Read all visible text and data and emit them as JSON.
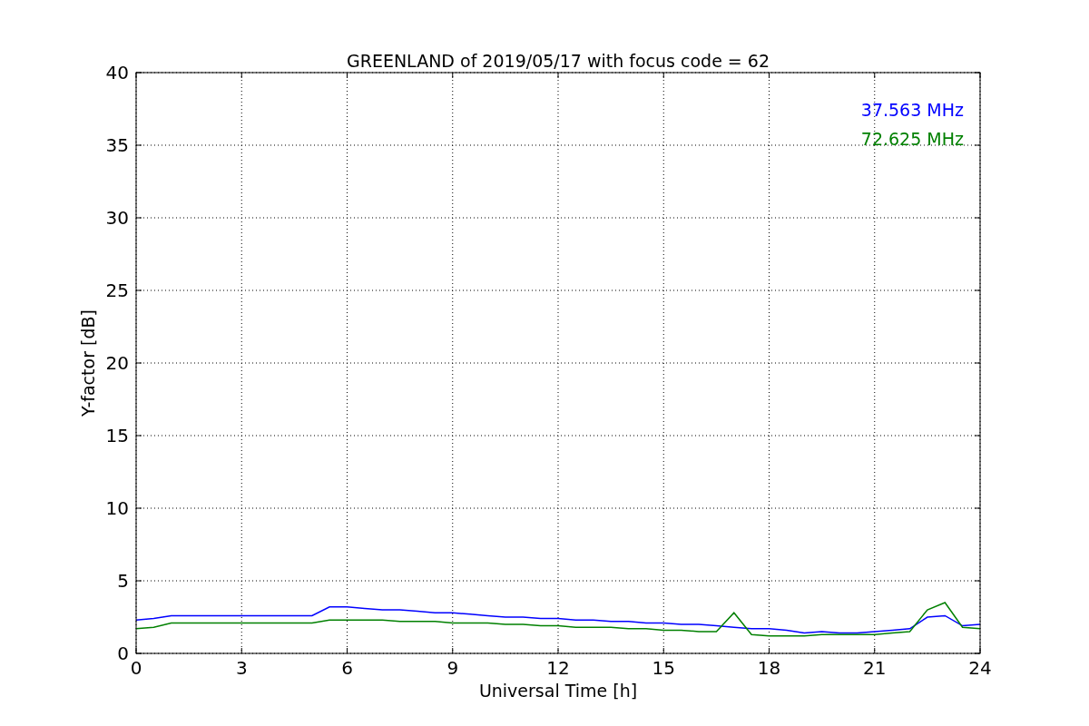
{
  "figure": {
    "chart_data": {
      "type": "line",
      "title": "GREENLAND of 2019/05/17 with focus code = 62",
      "xlabel": "Universal Time [h]",
      "ylabel": "Y-factor [dB]",
      "x": [
        0,
        0.5,
        1,
        1.5,
        2,
        2.5,
        3,
        3.5,
        4,
        4.5,
        5,
        5.5,
        6,
        6.5,
        7,
        7.5,
        8,
        8.5,
        9,
        9.5,
        10,
        10.5,
        11,
        11.5,
        12,
        12.5,
        13,
        13.5,
        14,
        14.5,
        15,
        15.5,
        16,
        16.5,
        17,
        17.5,
        18,
        18.5,
        19,
        19.5,
        20,
        20.5,
        21,
        21.5,
        22,
        22.5,
        23,
        23.5,
        24
      ],
      "series": [
        {
          "name": "37.563 MHz",
          "color": "#0000ff",
          "values": [
            2.3,
            2.4,
            2.6,
            2.6,
            2.6,
            2.6,
            2.6,
            2.6,
            2.6,
            2.6,
            2.6,
            3.2,
            3.2,
            3.1,
            3.0,
            3.0,
            2.9,
            2.8,
            2.8,
            2.7,
            2.6,
            2.5,
            2.5,
            2.4,
            2.4,
            2.3,
            2.3,
            2.2,
            2.2,
            2.1,
            2.1,
            2.0,
            2.0,
            1.9,
            1.8,
            1.7,
            1.7,
            1.6,
            1.4,
            1.5,
            1.4,
            1.4,
            1.5,
            1.6,
            1.7,
            2.5,
            2.6,
            1.9,
            2.0
          ]
        },
        {
          "name": "72.625 MHz",
          "color": "#008000",
          "values": [
            1.7,
            1.8,
            2.1,
            2.1,
            2.1,
            2.1,
            2.1,
            2.1,
            2.1,
            2.1,
            2.1,
            2.3,
            2.3,
            2.3,
            2.3,
            2.2,
            2.2,
            2.2,
            2.1,
            2.1,
            2.1,
            2.0,
            2.0,
            1.9,
            1.9,
            1.8,
            1.8,
            1.8,
            1.7,
            1.7,
            1.6,
            1.6,
            1.5,
            1.5,
            2.8,
            1.3,
            1.2,
            1.2,
            1.2,
            1.3,
            1.3,
            1.3,
            1.3,
            1.4,
            1.5,
            3.0,
            3.5,
            1.8,
            1.7
          ]
        }
      ],
      "grid": true,
      "xlim": [
        0,
        24
      ],
      "ylim": [
        0,
        40
      ],
      "xticks": [
        0,
        3,
        6,
        9,
        12,
        15,
        18,
        21,
        24
      ],
      "yticks": [
        0,
        5,
        10,
        15,
        20,
        25,
        30,
        35,
        40
      ]
    }
  }
}
